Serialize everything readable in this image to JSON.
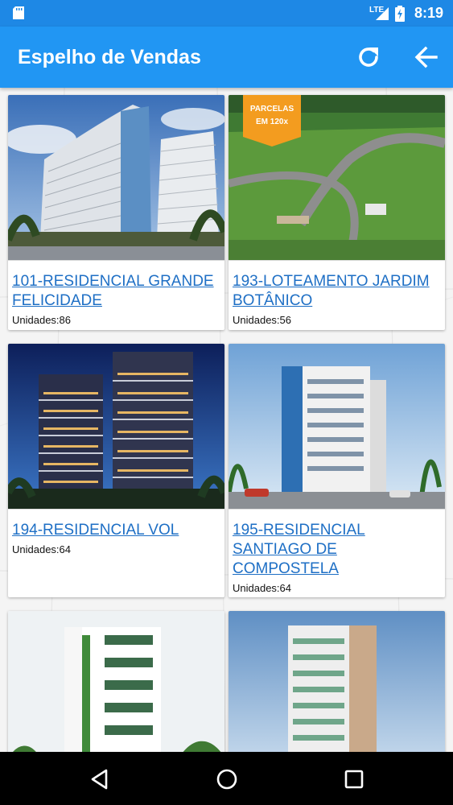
{
  "status_bar": {
    "network": "LTE",
    "time": "8:19"
  },
  "app_bar": {
    "title": "Espelho de Vendas"
  },
  "cards": [
    {
      "name": "101-RESIDENCIAL GRANDE FELICIDADE",
      "units": "Unidades:86"
    },
    {
      "name": "193-LOTEAMENTO JARDIM BOTÂNICO",
      "units": "Unidades:56",
      "banner_line1": "PARCELAS",
      "banner_line2": "EM 120x"
    },
    {
      "name": "194-RESIDENCIAL VOL",
      "units": "Unidades:64"
    },
    {
      "name": "195-RESIDENCIAL SANTIAGO DE COMPOSTELA",
      "units": "Unidades:64"
    },
    {
      "name": "",
      "units": ""
    },
    {
      "name": "",
      "units": ""
    }
  ],
  "colors": {
    "status_bar": "#1e88e5",
    "app_bar": "#2196f3",
    "link": "#1e6fc5",
    "banner": "#f39c1f"
  }
}
